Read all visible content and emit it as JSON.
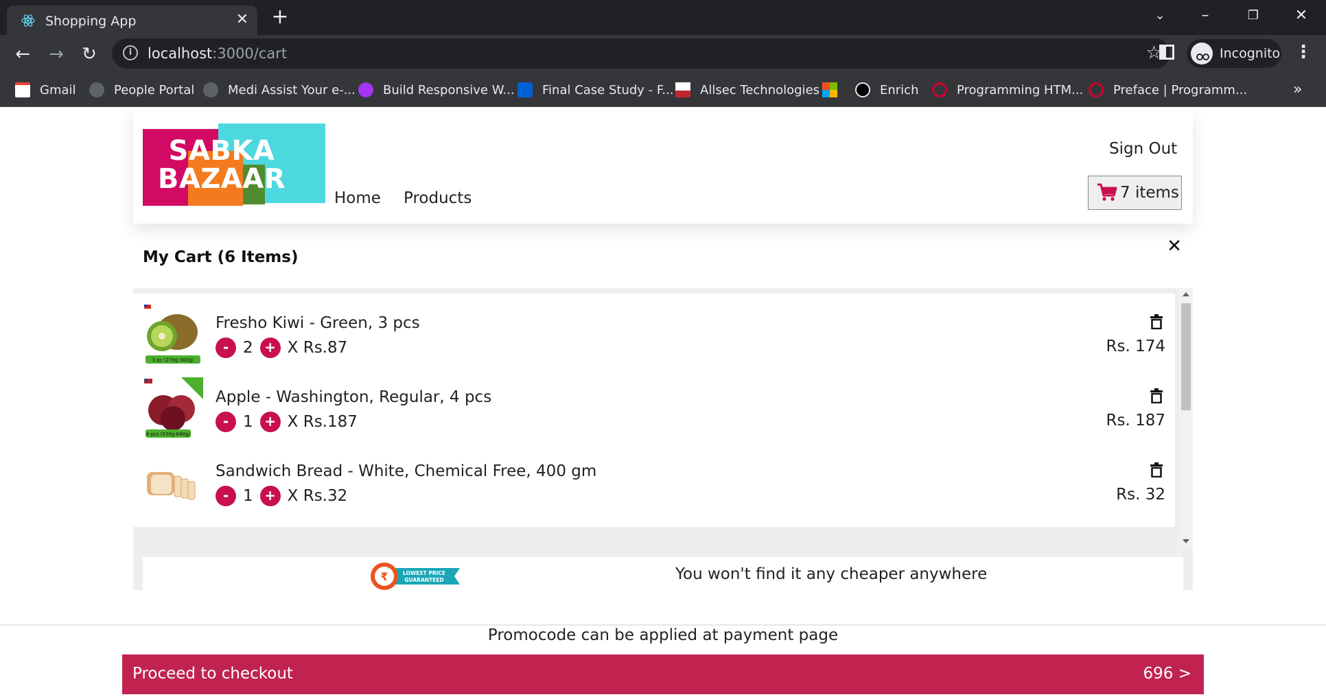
{
  "browser": {
    "tab_title": "Shopping App",
    "tab_close": "✕",
    "new_tab": "+",
    "url_host": "localhost",
    "url_path": ":3000/cart",
    "incognito_label": "Incognito",
    "bookmarks": [
      {
        "label": "Gmail",
        "icon": "gmail-icon",
        "color": "#ea4335"
      },
      {
        "label": "People Portal",
        "icon": "globe-icon",
        "color": "#5f6368"
      },
      {
        "label": "Medi Assist Your e-...",
        "icon": "globe-icon",
        "color": "#5f6368"
      },
      {
        "label": "Build Responsive W...",
        "icon": "udemy-icon",
        "color": "#a435f0"
      },
      {
        "label": "Final Case Study - F...",
        "icon": "box-icon",
        "color": "#0061d5"
      },
      {
        "label": "Allsec Technologies",
        "icon": "allsec-icon",
        "color": "#c0272d"
      },
      {
        "label": "",
        "icon": "microsoft-icon",
        "color": "#00a4ef"
      },
      {
        "label": "Enrich",
        "icon": "enrich-icon",
        "color": "#000000"
      },
      {
        "label": "Programming HTM...",
        "icon": "oreilly-icon",
        "color": "#d3002d"
      },
      {
        "label": "Preface | Programm...",
        "icon": "oreilly-icon",
        "color": "#d3002d"
      }
    ],
    "bookmarks_more": "»"
  },
  "header": {
    "logo_line1": "SABKA",
    "logo_line2": "BAZAAR",
    "nav": [
      "Home",
      "Products"
    ],
    "sign_out": "Sign Out",
    "cart_count": "7 items"
  },
  "cart": {
    "title": "My Cart (6 Items)",
    "close": "✕",
    "items": [
      {
        "name": "Fresho Kiwi - Green, 3 pcs",
        "qty": "2",
        "price": "X Rs.87",
        "total": "Rs. 174",
        "minus": "-",
        "plus": "+"
      },
      {
        "name": "Apple - Washington, Regular, 4 pcs",
        "qty": "1",
        "price": "X Rs.187",
        "total": "Rs. 187",
        "minus": "-",
        "plus": "+"
      },
      {
        "name": "Sandwich Bread - White, Chemical Free, 400 gm",
        "qty": "1",
        "price": "X Rs.32",
        "total": "Rs. 32",
        "minus": "-",
        "plus": "+"
      }
    ],
    "badge_line1": "LOWEST PRICE",
    "badge_line2": "GUARANTEED",
    "cheaper_text": "You won't find it any cheaper anywhere",
    "promo_note": "Promocode can be applied at payment page",
    "checkout_label": "Proceed to checkout",
    "checkout_amount": "696 >"
  },
  "colors": {
    "accent": "#c0234f",
    "qty_button": "#c8104f",
    "chrome_dark": "#202124",
    "chrome_mid": "#35363a"
  }
}
